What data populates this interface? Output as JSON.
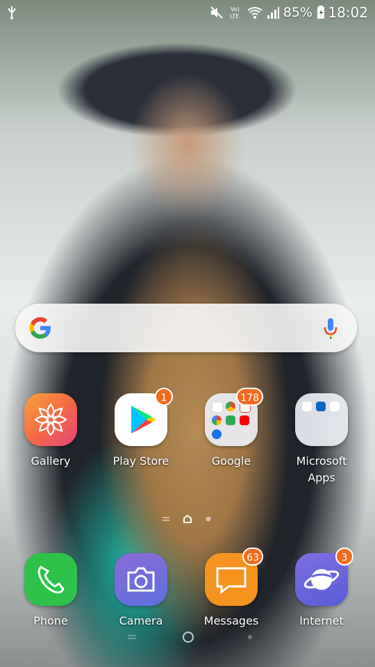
{
  "status_bar": {
    "battery_percent": "85%",
    "time": "18:02",
    "icons": [
      "usb-icon",
      "mute-icon",
      "volte-icon",
      "wifi-icon",
      "signal-icon",
      "battery-icon"
    ]
  },
  "search": {
    "icons": [
      "google-g-icon",
      "mic-icon"
    ],
    "colors": {
      "blue": "#4285F4",
      "red": "#EA4335",
      "yellow": "#FBBC05",
      "green": "#34A853"
    }
  },
  "apps": [
    {
      "label": "Gallery",
      "badge": null,
      "icon": "gallery-flower-icon"
    },
    {
      "label": "Play Store",
      "badge": "1",
      "icon": "play-store-icon"
    },
    {
      "label": "Google",
      "badge": "178",
      "icon": "google-folder-icon"
    },
    {
      "label": "Microsoft\nApps",
      "badge": null,
      "icon": "microsoft-folder-icon"
    }
  ],
  "dock": [
    {
      "label": "Phone",
      "badge": null,
      "icon": "phone-icon"
    },
    {
      "label": "Camera",
      "badge": null,
      "icon": "camera-icon"
    },
    {
      "label": "Messages",
      "badge": "63",
      "icon": "messages-icon"
    },
    {
      "label": "Internet",
      "badge": "3",
      "icon": "internet-icon"
    }
  ],
  "pager": {
    "current_page": 1,
    "icons": [
      "menu-lines-icon",
      "home-page-icon",
      "page-dot-icon"
    ]
  },
  "navigation": {
    "icons": [
      "recents-icon",
      "home-button-icon",
      "back-icon"
    ]
  }
}
